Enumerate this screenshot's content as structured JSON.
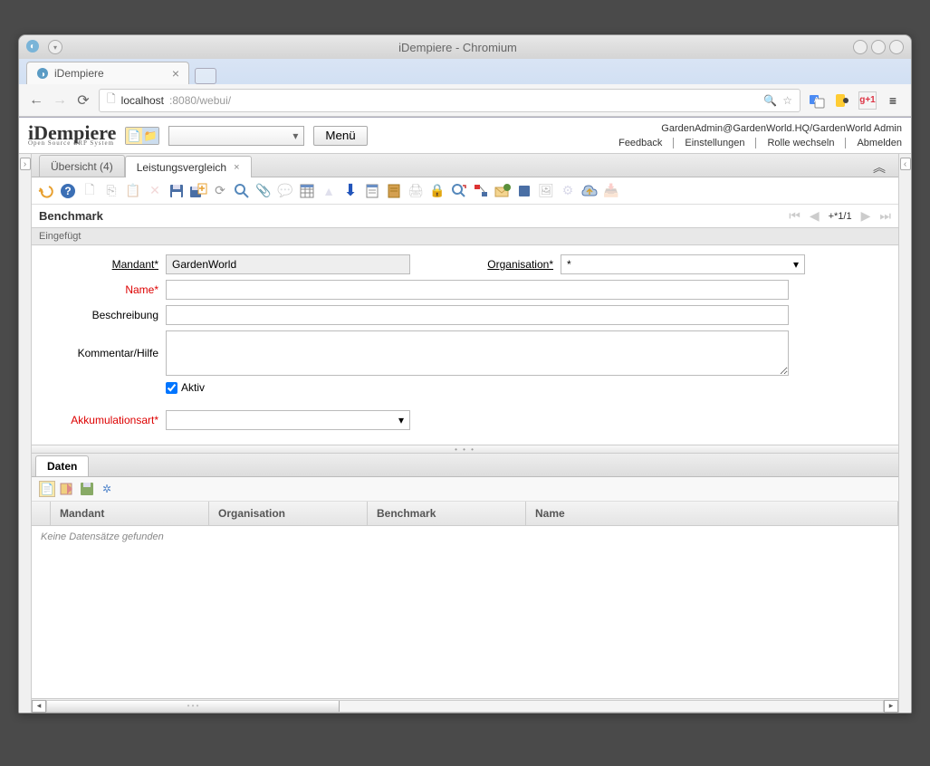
{
  "window": {
    "title": "iDempiere - Chromium"
  },
  "browser": {
    "tab_title": "iDempiere",
    "url_host": "localhost",
    "url_rest": ":8080/webui/"
  },
  "header": {
    "logo_main": "iDempiere",
    "logo_sub": "Open Source ERP System",
    "menu_btn": "Menü",
    "context": "GardenAdmin@GardenWorld.HQ/GardenWorld Admin",
    "links": [
      "Feedback",
      "Einstellungen",
      "Rolle wechseln",
      "Abmelden"
    ]
  },
  "tabs": {
    "overview": "Übersicht (4)",
    "active": "Leistungsvergleich"
  },
  "form": {
    "title": "Benchmark",
    "status": "Eingefügt",
    "nav_counter": "+*1/1",
    "fields": {
      "mandant_lbl": "Mandant*",
      "mandant_val": "GardenWorld",
      "org_lbl": "Organisation*",
      "org_val": "*",
      "name_lbl": "Name*",
      "name_val": "",
      "desc_lbl": "Beschreibung",
      "desc_val": "",
      "comment_lbl": "Kommentar/Hilfe",
      "comment_val": "",
      "active_lbl": "Aktiv",
      "accum_lbl": "Akkumulationsart*",
      "accum_val": ""
    }
  },
  "data_section": {
    "tab": "Daten",
    "columns": [
      "Mandant",
      "Organisation",
      "Benchmark",
      "Name"
    ],
    "empty": "Keine Datensätze gefunden"
  }
}
